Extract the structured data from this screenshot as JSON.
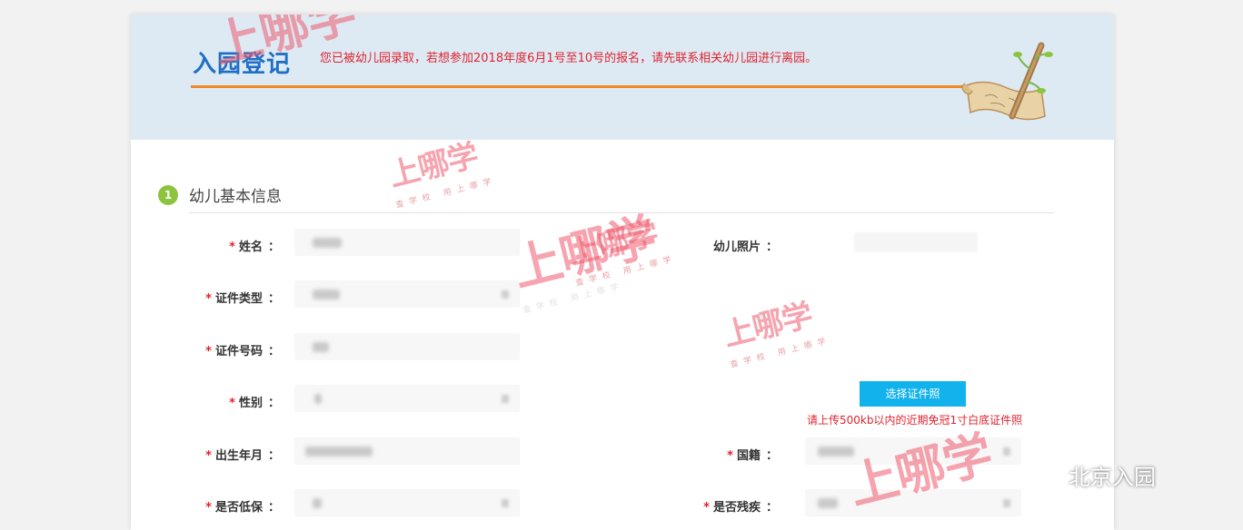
{
  "banner": {
    "title": "入园登记",
    "notice": "您已被幼儿园录取，若想参加2018年度6月1号至10号的报名，请先联系相关幼儿园进行离园。"
  },
  "section": {
    "step": "1",
    "title": "幼儿基本信息"
  },
  "form": {
    "required_mark": "*",
    "colon": "：",
    "left_fields": [
      {
        "label": "姓名",
        "required": true,
        "type": "text"
      },
      {
        "label": "证件类型",
        "required": true,
        "type": "select"
      },
      {
        "label": "证件号码",
        "required": true,
        "type": "text"
      },
      {
        "label": "性别",
        "required": true,
        "type": "select"
      },
      {
        "label": "出生年月",
        "required": true,
        "type": "text"
      },
      {
        "label": "是否低保",
        "required": true,
        "type": "select"
      }
    ],
    "photo_label": "幼儿照片",
    "upload_button": "选择证件照",
    "upload_hint": "请上传500kb以内的近期免冠1寸白底证件照",
    "right_fields": [
      {
        "label": "国籍",
        "required": true,
        "type": "select"
      },
      {
        "label": "是否残疾",
        "required": true,
        "type": "select"
      }
    ]
  },
  "watermarks": {
    "brand": "上哪学",
    "slogan": "查学校 用上哪学"
  },
  "wechat_tag": "北京入园",
  "icons": [
    "scroll-pen-icon",
    "wechat-icon"
  ],
  "colors": {
    "banner_bg": "#ddeaf3",
    "title_blue": "#1f6fc4",
    "notice_red": "#e0232f",
    "accent_orange": "#f08a24",
    "step_green": "#8cc43f",
    "button_blue": "#12b2ec"
  }
}
